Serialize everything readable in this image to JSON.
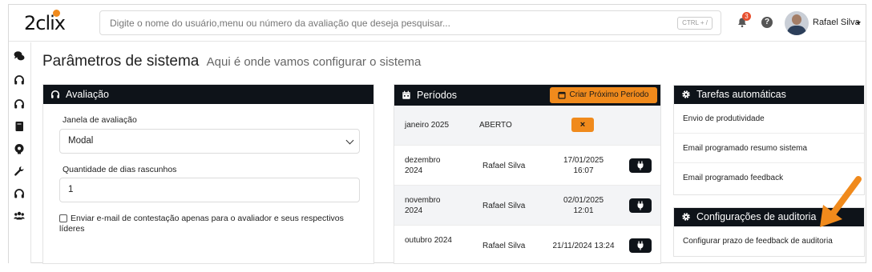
{
  "header": {
    "logo": "2clix",
    "search_placeholder": "Digite o nome do usuário,menu ou número da avaliação que deseja pesquisar...",
    "shortcut": "CTRL + /",
    "notification_count": "3",
    "help_label": "?",
    "user_name": "Rafael Silva"
  },
  "page": {
    "title": "Parâmetros de sistema",
    "subtitle": "Aqui é onde vamos configurar o sistema"
  },
  "sidebar": {
    "icons": [
      "chat-icon",
      "headset-icon",
      "headset-icon",
      "book-icon",
      "gear-brain-icon",
      "wrench-icon",
      "headset-icon",
      "users-icon"
    ]
  },
  "avaliacao": {
    "title": "Avaliação",
    "janela_label": "Janela de avaliação",
    "janela_value": "Modal",
    "dias_label": "Quantidade de dias rascunhos",
    "dias_value": "1",
    "checkbox_label": "Enviar e-mail de contestação apenas para o avaliador e seus respectivos líderes",
    "checkbox_checked": false
  },
  "periodos": {
    "title": "Períodos",
    "create_button": "Criar Próximo Período",
    "rows": [
      {
        "period": "janeiro 2025",
        "user": "ABERTO",
        "date": "",
        "action": "close"
      },
      {
        "period": "dezembro 2024",
        "user": "Rafael Silva",
        "date": "17/01/2025 16:07",
        "action": "plug"
      },
      {
        "period": "novembro 2024",
        "user": "Rafael Silva",
        "date": "02/01/2025 12:01",
        "action": "plug"
      },
      {
        "period": "outubro 2024",
        "user": "Rafael Silva",
        "date": "21/11/2024 13:24",
        "action": "plug"
      }
    ]
  },
  "tarefas": {
    "title": "Tarefas automáticas",
    "items": [
      "Envio de produtividade",
      "Email programado resumo sistema",
      "Email programado feedback"
    ]
  },
  "auditoria": {
    "title": "Configurações de auditoria",
    "items": [
      "Configurar prazo de feedback de auditoria"
    ]
  },
  "colors": {
    "dark": "#0e1319",
    "accent": "#f08a1c",
    "badge": "#e8502f"
  }
}
